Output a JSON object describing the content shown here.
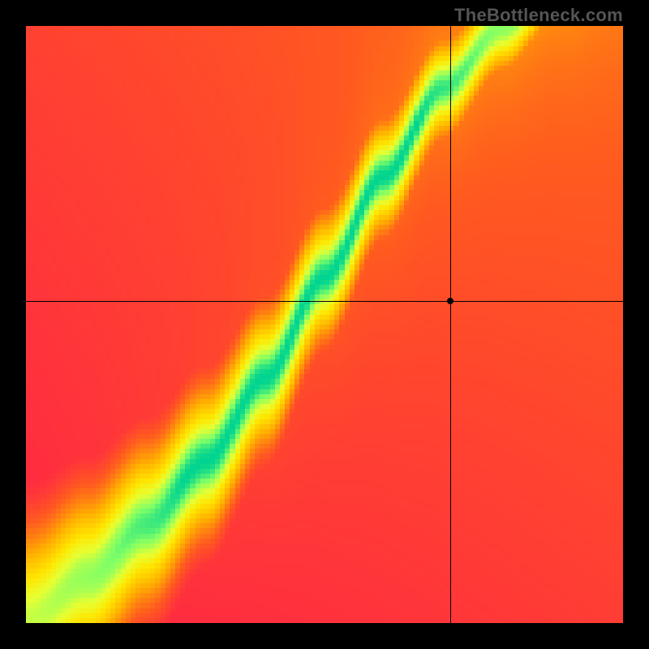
{
  "watermark": "TheBottleneck.com",
  "chart_data": {
    "type": "heatmap",
    "title": "",
    "xlabel": "",
    "ylabel": "",
    "xlim": [
      0,
      100
    ],
    "ylim": [
      0,
      100
    ],
    "grid": false,
    "legend": false,
    "crosshair": {
      "x": 71,
      "y": 54
    },
    "marker": {
      "x": 71,
      "y": 54
    },
    "description": "A 2D bottleneck field: score(x,y) from 0 (red, severe bottleneck) to 1 (green, balanced) based on distance of (x,y) from an S-shaped optimal curve y=f(x). Band narrows with x.",
    "optimal_curve_samples": [
      {
        "x": 0,
        "y": 0
      },
      {
        "x": 10,
        "y": 7
      },
      {
        "x": 20,
        "y": 16
      },
      {
        "x": 30,
        "y": 27
      },
      {
        "x": 40,
        "y": 41
      },
      {
        "x": 50,
        "y": 58
      },
      {
        "x": 60,
        "y": 75
      },
      {
        "x": 70,
        "y": 90
      },
      {
        "x": 80,
        "y": 100
      },
      {
        "x": 90,
        "y": 108
      },
      {
        "x": 100,
        "y": 114
      }
    ],
    "colorscale": [
      {
        "t": 0.0,
        "hex": "#ff1a4d"
      },
      {
        "t": 0.25,
        "hex": "#ff5a1f"
      },
      {
        "t": 0.5,
        "hex": "#ffb000"
      },
      {
        "t": 0.7,
        "hex": "#ffe600"
      },
      {
        "t": 0.82,
        "hex": "#e6ff33"
      },
      {
        "t": 0.92,
        "hex": "#80ff66"
      },
      {
        "t": 1.0,
        "hex": "#00d490"
      }
    ],
    "resolution": 120
  }
}
